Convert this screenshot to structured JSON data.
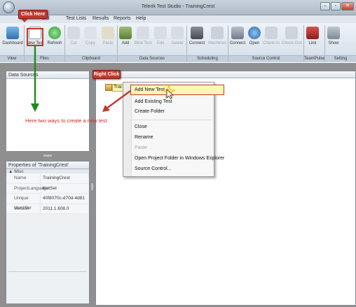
{
  "window": {
    "title": "Telerik Test Studio - TrainingCrest",
    "btn_min": "–",
    "btn_max": "▫",
    "btn_close": "✕"
  },
  "menu": [
    "ord",
    "Test Lists",
    "Results",
    "Reports",
    "Help"
  ],
  "ribbon": {
    "buttons": [
      "Dashboard",
      "New Test",
      "Refresh",
      "Cut",
      "Copy",
      "Paste",
      "Add",
      "Bind Test",
      "Edit",
      "Delete",
      "Connect",
      "Machines",
      "Connect",
      "Open",
      "Check-In",
      "Check-Out",
      "Link",
      "Show"
    ],
    "groups": [
      "View",
      "Files",
      "Clipboard",
      "Data Sources",
      "Scheduling",
      "Source Control",
      "TeamPulse",
      "Setting"
    ]
  },
  "data_sources_panel": {
    "title": "Data Sources"
  },
  "properties_panel": {
    "title": "Properties of 'TrainingCrest'",
    "category": "Misc",
    "rows": [
      {
        "key": "Name",
        "value": "TrainingCrest"
      },
      {
        "key": "ProjectLanguage",
        "value": "NotSet"
      },
      {
        "key": "Unique Identifier",
        "value": "40f8070c-d70d-4d81"
      },
      {
        "key": "Version",
        "value": "2011.1.608.0"
      }
    ]
  },
  "tree": {
    "node": "Trai"
  },
  "context_menu": {
    "items": [
      "Add New Test",
      "Add Existing Test",
      "Create Folder",
      "Close",
      "Rename",
      "Paste",
      "Open Project Folder in Windows Explorer",
      "Source Control..."
    ]
  },
  "annotations": {
    "click_here": "Click Here",
    "right_click": "Right Click",
    "note": "Here two ways to create a new test"
  },
  "colors": {
    "accent_red": "#c0392b",
    "arrow_green": "#1e8a1e",
    "highlight": "#fff6b8"
  }
}
